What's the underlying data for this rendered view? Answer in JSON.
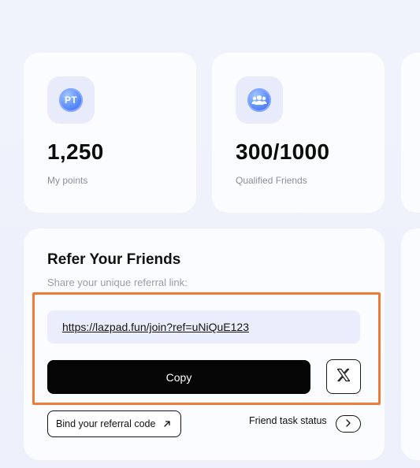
{
  "stats": {
    "points": {
      "value": "1,250",
      "label": "My points",
      "icon_text": "PT",
      "icon": "points-coin-icon"
    },
    "friends": {
      "value": "300/1000",
      "label": "Qualified Friends",
      "icon": "group-users-icon"
    }
  },
  "referral": {
    "title": "Refer Your Friends",
    "subtitle": "Share your unique referral link:",
    "link": "https://lazpad.fun/join?ref=uNiQuE123",
    "copy_label": "Copy",
    "share_x_icon": "x-logo-icon",
    "bind_label": "Bind your referral code",
    "bind_icon": "arrow-up-right-icon",
    "task_status_label": "Friend task status",
    "task_status_icon": "chevron-right-icon"
  },
  "colors": {
    "highlight": "#f07a37",
    "accent_blue": "#5b8dfa",
    "background": "#eef1fb",
    "button_dark": "#050505"
  }
}
